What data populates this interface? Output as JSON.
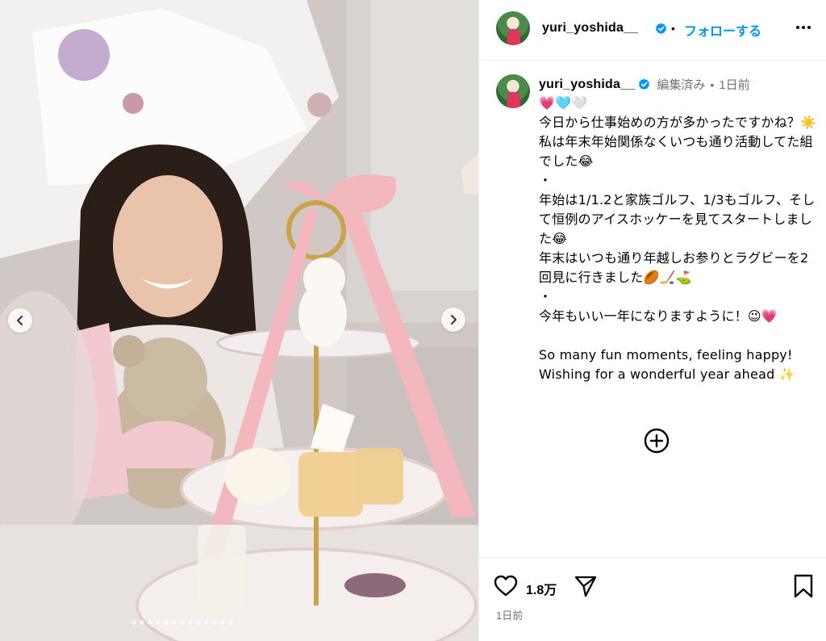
{
  "post": {
    "username": "yuri_yoshida__",
    "verified": true,
    "follow_label": "フォローする",
    "separator": "•",
    "image_alt": "Woman smiling next to a pink afternoon tea stand with a teddy bear and white Christmas tree",
    "carousel": {
      "slide_count": 13,
      "active_index": 4
    }
  },
  "caption": {
    "username": "yuri_yoshida__",
    "edited_label": "編集済み",
    "separator": "•",
    "time": "1日前",
    "text": "💗🩵🤍\n今日から仕事始めの方が多かったですかね？☀️\n私は年末年始関係なくいつも通り活動してた組でした😂\n・\n年始は1/1.2と家族ゴルフ、1/3もゴルフ、そして恒例のアイスホッケーを見てスタートしました😂\n年末はいつも通り年越しお参りとラグビーを2回見に行きました🏉🏒⛳\n・\n今年もいい一年になりますように！😉💗\n\nSo many fun moments, feeling happy!\nWishing for a wonderful year ahead ✨"
  },
  "actions": {
    "like_count": "1.8万",
    "date": "1日前"
  },
  "icons": {
    "more": "more-horizontal-icon",
    "verified": "verified-badge-icon",
    "add_comment": "add-circle-icon",
    "like": "heart-icon",
    "share": "send-icon",
    "save": "bookmark-icon",
    "prev": "chevron-left-icon",
    "next": "chevron-right-icon"
  },
  "colors": {
    "accent": "#0095f6",
    "verified": "#0095f6",
    "muted_text": "#737373",
    "ribbon_pink": "#f2b8bd"
  }
}
